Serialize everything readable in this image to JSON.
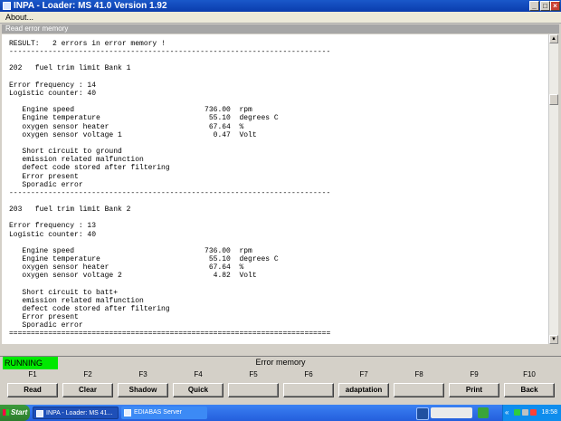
{
  "window": {
    "title": "INPA - Loader: MS 41.0 Version 1.92",
    "buttons": {
      "minimize": "_",
      "maximize": "□",
      "close": "×"
    }
  },
  "menu": {
    "about": "About..."
  },
  "panel": {
    "title": "Read error memory"
  },
  "report": {
    "lines": [
      "RESULT:   2 errors in error memory !",
      "--------------------------------------------------------------------------",
      "",
      "202   fuel trim limit Bank 1",
      "",
      "Error frequency : 14",
      "Logistic counter: 40",
      "",
      "   Engine speed                              736.00  rpm",
      "   Engine temperature                         55.10  degrees C",
      "   oxygen sensor heater                       67.64  %",
      "   oxygen sensor voltage 1                     0.47  Volt",
      "",
      "   Short circuit to ground",
      "   emission related malfunction",
      "   defect code stored after filtering",
      "   Error present",
      "   Sporadic error",
      "--------------------------------------------------------------------------",
      "",
      "203   fuel trim limit Bank 2",
      "",
      "Error frequency : 13",
      "Logistic counter: 40",
      "",
      "   Engine speed                              736.00  rpm",
      "   Engine temperature                         55.10  degrees C",
      "   oxygen sensor heater                       67.64  %",
      "   oxygen sensor voltage 2                     4.82  Volt",
      "",
      "   Short circuit to batt+",
      "   emission related malfunction",
      "   defect code stored after filtering",
      "   Error present",
      "   Sporadic error",
      "=========================================================================="
    ]
  },
  "status": {
    "state": "RUNNING",
    "state_color": "#00e800",
    "screen_name": "Error memory"
  },
  "function_keys": [
    {
      "key": "F1",
      "label": "Read"
    },
    {
      "key": "F2",
      "label": "Clear"
    },
    {
      "key": "F3",
      "label": "Shadow"
    },
    {
      "key": "F4",
      "label": "Quick"
    },
    {
      "key": "F5",
      "label": ""
    },
    {
      "key": "F6",
      "label": ""
    },
    {
      "key": "F7",
      "label": "adaptation"
    },
    {
      "key": "F8",
      "label": ""
    },
    {
      "key": "F9",
      "label": "Print"
    },
    {
      "key": "F10",
      "label": "Back"
    }
  ],
  "taskbar": {
    "start": "Start",
    "tasks": [
      "INPA - Loader: MS 41...",
      "EDIABAS Server"
    ],
    "tray_app": "«",
    "clock": "18:58"
  }
}
